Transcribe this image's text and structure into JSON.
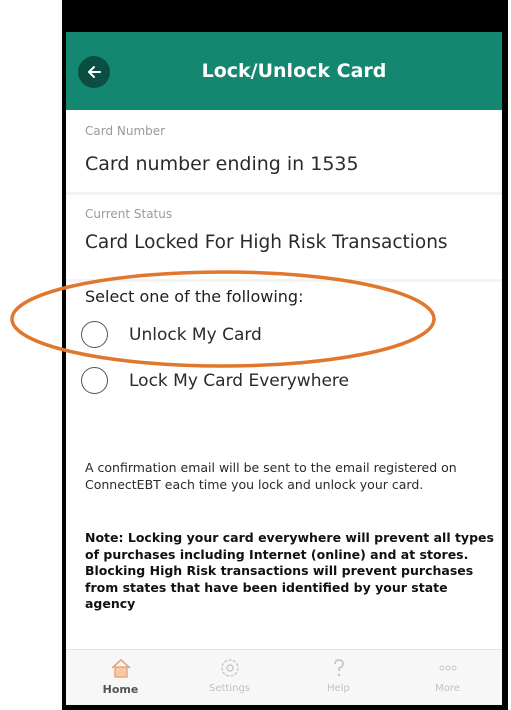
{
  "colors": {
    "header_bg": "#13876f",
    "back_button_bg": "#0a4f41",
    "annotation_stroke": "#e0772d",
    "home_icon": "#e8a27a"
  },
  "header": {
    "title": "Lock/Unlock Card",
    "back_icon": "arrow-left-icon"
  },
  "card_number": {
    "label": "Card Number",
    "value": "Card number ending in 1535"
  },
  "current_status": {
    "label": "Current Status",
    "value": "Card Locked For High Risk Transactions"
  },
  "options": {
    "prompt": "Select one of the following:",
    "items": [
      {
        "label": "Unlock My Card",
        "selected": false
      },
      {
        "label": "Lock My Card Everywhere",
        "selected": false
      }
    ]
  },
  "info": {
    "confirmation": "A confirmation email will be sent to the email registered on ConnectEBT each time you lock and unlock your card.",
    "note": "Note: Locking your card everywhere will prevent all types of purchases including Internet (online) and at stores. Blocking High Risk transactions will prevent purchases from states that have been identified by your state agency"
  },
  "tabbar": {
    "tabs": [
      {
        "label": "Home",
        "icon": "home-icon",
        "active": true
      },
      {
        "label": "Settings",
        "icon": "gear-icon",
        "active": false
      },
      {
        "label": "Help",
        "icon": "question-icon",
        "active": false
      },
      {
        "label": "More",
        "icon": "more-dots-icon",
        "active": false
      }
    ]
  }
}
